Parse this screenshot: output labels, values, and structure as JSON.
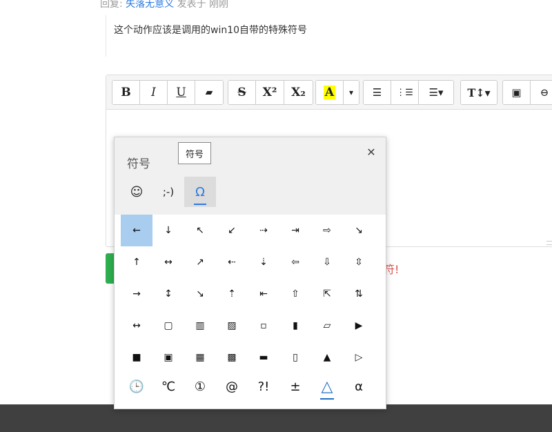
{
  "reply": {
    "prefix": "回复: ",
    "author": "失落无意义",
    "suffix": " 发表于 刚刚"
  },
  "quote": {
    "text": "这个动作应该是调用的win10自带的特殊符号"
  },
  "toolbar": {
    "groups": [
      [
        "B",
        "I",
        "U",
        "▰"
      ],
      [
        "S",
        "X²",
        "X₂"
      ],
      [
        "A",
        "▾"
      ],
      [
        "☰",
        "⋮☰",
        "☰▾"
      ],
      [
        "T↕▾"
      ],
      [
        "▣",
        "⊖"
      ]
    ]
  },
  "red_text": "符!",
  "panel": {
    "title": "符号",
    "tooltip": "符号",
    "close": "✕",
    "tabs": [
      "☺",
      ";-)",
      "Ω"
    ],
    "symbols": [
      [
        "←",
        "↓",
        "↖",
        "↙",
        "⇢",
        "⇥",
        "⇨",
        "↘"
      ],
      [
        "↑",
        "↔",
        "↗",
        "⇠",
        "⇣",
        "⇦",
        "⇩",
        "⇳"
      ],
      [
        "→",
        "↕",
        "↘",
        "⇡",
        "⇤",
        "⇧",
        "⇱",
        "⇅"
      ],
      [
        "↔",
        "▢",
        "▥",
        "▨",
        "▫",
        "▮",
        "▱",
        "▶"
      ],
      [
        "■",
        "▣",
        "▦",
        "▩",
        "▬",
        "▯",
        "▲",
        "▷"
      ],
      [
        "🕒",
        "℃",
        "①",
        "@",
        "?!",
        "±",
        "△",
        "α"
      ]
    ]
  }
}
